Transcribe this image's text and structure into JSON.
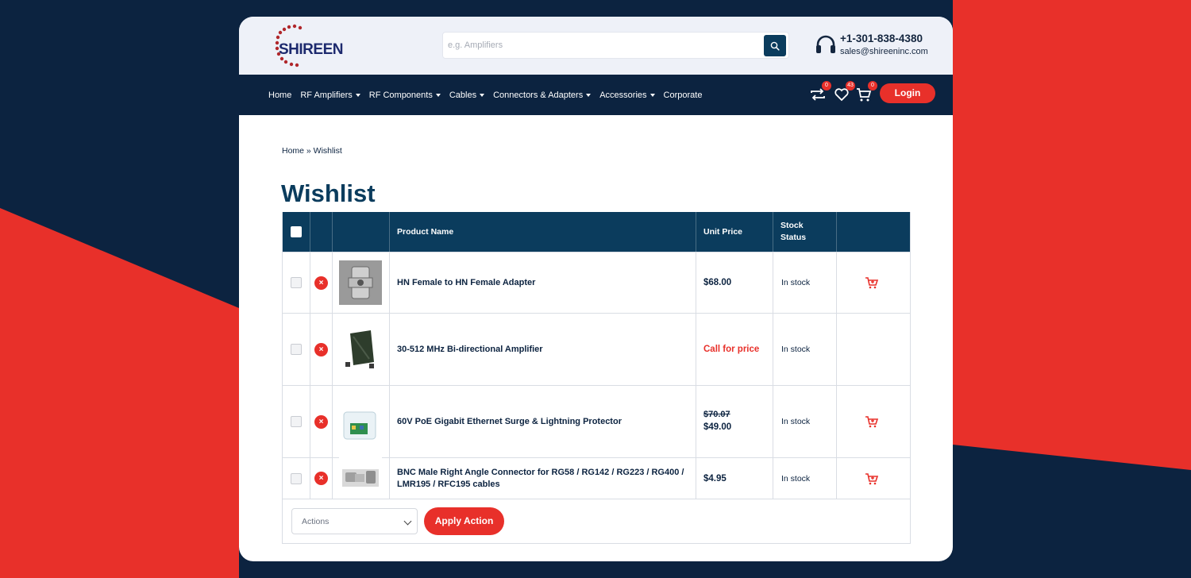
{
  "colors": {
    "navy": "#0c2340",
    "header_blue": "#0b3c5d",
    "red": "#e8302a"
  },
  "brand": {
    "name": "SHIREEN"
  },
  "search": {
    "placeholder": "e.g. Amplifiers",
    "button_icon": "search-icon"
  },
  "contact": {
    "phone": "+1-301-838-4380",
    "email": "sales@shireeninc.com",
    "icon": "headset-icon"
  },
  "nav": {
    "items": [
      {
        "label": "Home",
        "dropdown": false
      },
      {
        "label": "RF Amplifiers",
        "dropdown": true
      },
      {
        "label": "RF Components",
        "dropdown": true
      },
      {
        "label": "Cables",
        "dropdown": true
      },
      {
        "label": "Connectors & Adapters",
        "dropdown": true
      },
      {
        "label": "Accessories",
        "dropdown": true
      },
      {
        "label": "Corporate",
        "dropdown": false
      }
    ],
    "compare_count": "0",
    "wishlist_count": "43",
    "cart_count": "0",
    "login_label": "Login"
  },
  "breadcrumb": "Home » Wishlist",
  "page_title": "Wishlist",
  "table": {
    "headers": {
      "product": "Product Name",
      "price": "Unit Price",
      "stock": "Stock Status"
    },
    "rows": [
      {
        "name": "HN Female to HN Female Adapter",
        "price": "$68.00",
        "stock": "In stock",
        "cart": true
      },
      {
        "name": "30-512 MHz Bi-directional Amplifier",
        "price": "Call for price",
        "stock": "In stock",
        "cart": false
      },
      {
        "name": "60V PoE Gigabit Ethernet Surge & Lightning Protector",
        "old_price": "$70.07",
        "price": "$49.00",
        "stock": "In stock",
        "cart": true
      },
      {
        "name": "BNC Male Right Angle Connector for RG58 / RG142 / RG223 / RG400 / LMR195 / RFC195 cables",
        "price": "$4.95",
        "stock": "In stock",
        "cart": true
      }
    ]
  },
  "footer": {
    "actions_value": "Actions",
    "apply_label": "Apply Action"
  }
}
